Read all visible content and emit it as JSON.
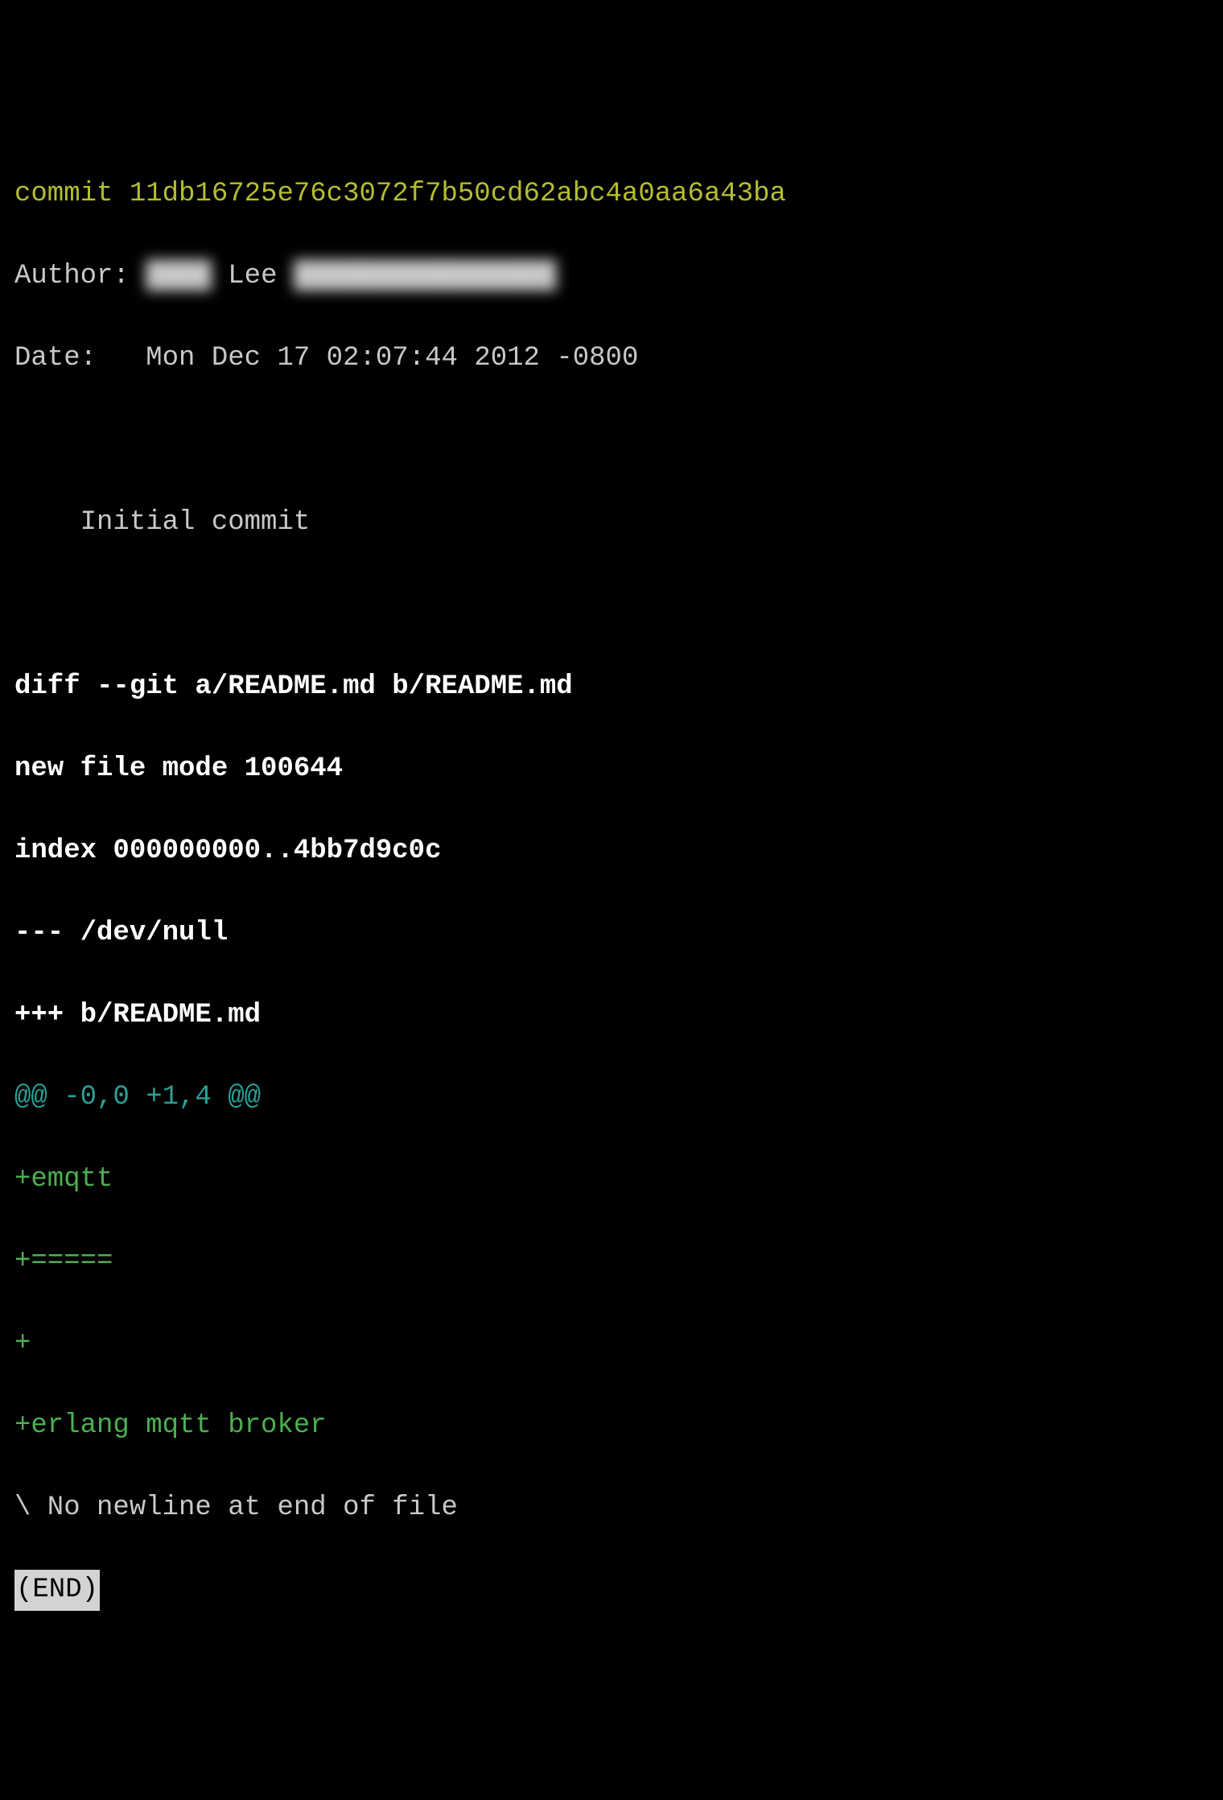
{
  "commit": {
    "label": "commit",
    "hash": "11db16725e76c3072f7b50cd62abc4a0aa6a43ba"
  },
  "author": {
    "label": "Author:",
    "name_redacted": "████",
    "name_visible": "Lee",
    "email_redacted": "████████████████"
  },
  "date": {
    "label": "Date:",
    "value": "Mon Dec 17 02:07:44 2012 -0800"
  },
  "message": "Initial commit",
  "diff": {
    "header": "diff --git a/README.md b/README.md",
    "mode": "new file mode 100644",
    "index": "index 000000000..4bb7d9c0c",
    "from": "--- /dev/null",
    "to": "+++ b/README.md",
    "hunk": "@@ -0,0 +1,4 @@",
    "added": [
      "+emqtt",
      "+=====",
      "+",
      "+erlang mqtt broker"
    ],
    "no_newline": "\\ No newline at end of file"
  },
  "pager_end": "(END)"
}
